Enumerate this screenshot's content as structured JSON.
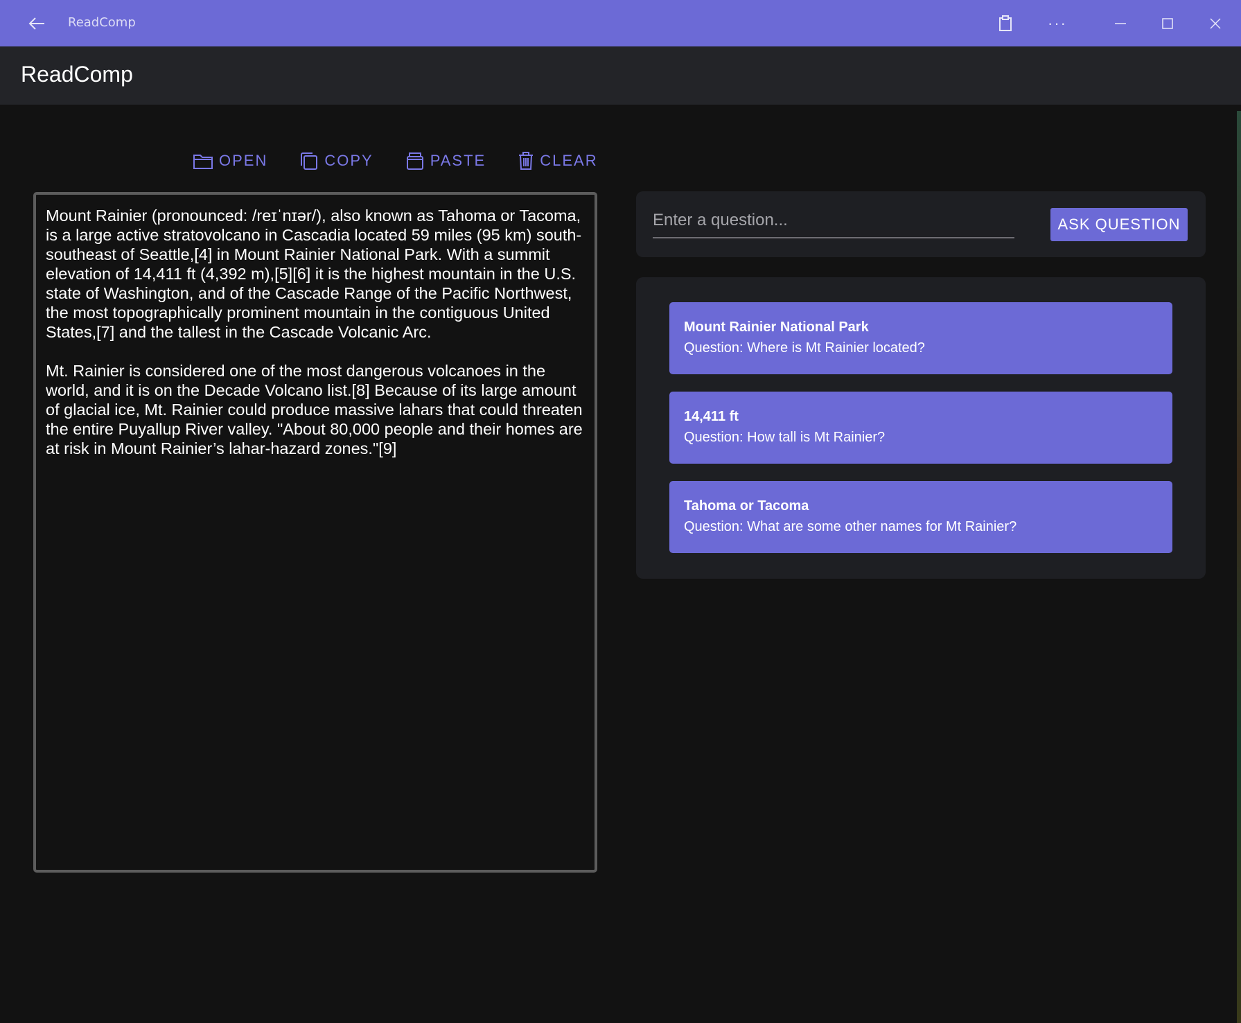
{
  "titlebar": {
    "title": "ReadComp",
    "back_icon": "arrow-left-icon",
    "clipboard_icon": "clipboard-icon",
    "more_label": "···",
    "minimize_icon": "minimize-icon",
    "maximize_icon": "maximize-icon",
    "close_icon": "close-icon"
  },
  "appbar": {
    "app_name": "ReadComp"
  },
  "toolbar": {
    "open_label": "OPEN",
    "copy_label": "COPY",
    "paste_label": "PASTE",
    "clear_label": "CLEAR"
  },
  "passage": {
    "text": "Mount Rainier (pronounced: /reɪˈnɪər/), also known as Tahoma or Tacoma, is a large active stratovolcano in Cascadia located 59 miles (95 km) south-southeast of Seattle,[4] in Mount Rainier National Park. With a summit elevation of 14,411 ft (4,392 m),[5][6] it is the highest mountain in the U.S. state of Washington, and of the Cascade Range of the Pacific Northwest, the most topographically prominent mountain in the contiguous United States,[7] and the tallest in the Cascade Volcanic Arc.\n\nMt. Rainier is considered one of the most dangerous volcanoes in the world, and it is on the Decade Volcano list.[8] Because of its large amount of glacial ice, Mt. Rainier could produce massive lahars that could threaten the entire Puyallup River valley. \"About 80,000 people and their homes are at risk in Mount Rainier’s lahar-hazard zones.\"[9]"
  },
  "question_input": {
    "value": "",
    "placeholder": "Enter a question..."
  },
  "ask_button": {
    "label": "ASK QUESTION"
  },
  "answers": [
    {
      "answer": "Mount Rainier National Park",
      "question": "Question: Where is Mt Rainier located?"
    },
    {
      "answer": "14,411 ft",
      "question": "Question: How tall is Mt Rainier?"
    },
    {
      "answer": "Tahoma or Tacoma",
      "question": "Question: What are some other names for Mt Rainier?"
    }
  ],
  "colors": {
    "accent": "#6c6ad6",
    "background": "#121212",
    "panel": "#1e1f23",
    "appbar": "#232428"
  }
}
